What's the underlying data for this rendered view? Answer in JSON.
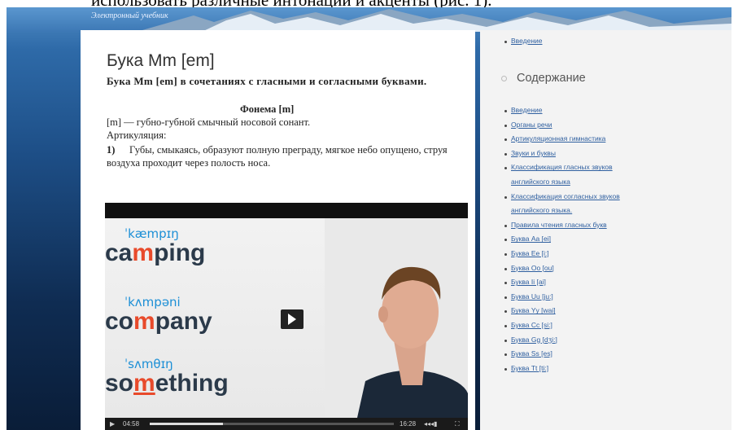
{
  "caption_top": "использовать различные интонации и акценты (рис. 1).",
  "site": {
    "title": "Электронный учебник"
  },
  "main": {
    "title": "Бука Mm [em]",
    "subheading": "Бука Mm [em] в сочетаниях с гласными и согласными буквами.",
    "phoneme_title": "Фонема [m]",
    "phoneme_desc": "[m] — губно-губной смычный носовой сонант.",
    "articulation_label": "Артикуляция:",
    "item_number": "1)",
    "item_text": "Губы, смыкаясь, образуют полную преграду, мягкое небо опущено, струя воздуха проходит через полость носа."
  },
  "video": {
    "words": [
      {
        "ipa": "ˈkæmpɪŋ",
        "pre": "ca",
        "hl": "m",
        "post": "ping"
      },
      {
        "ipa": "ˈkʌmpəni",
        "pre": "co",
        "hl": "m",
        "post": "pany"
      },
      {
        "ipa": "ˈsʌmθɪŋ",
        "pre": "so",
        "hl": "m",
        "post": "ething"
      }
    ],
    "time_current": "04:58",
    "time_total": "16:28",
    "progress": 0.3
  },
  "sidebar": {
    "top_link": "Введение",
    "heading": "Содержание",
    "items": [
      "Введение",
      "Органы речи",
      "Артикуляционная гимнастика",
      "Звуки и буквы",
      "Классификация гласных звуков",
      "английского языка",
      "Классификация согласных звуков",
      "английского языка.",
      "Правила чтения гласных букв",
      "Буква Aa [ei]",
      "Буква Ee [i:]",
      "Буква Oo [ou]",
      "Буква Ii [ai]",
      "Буква Uu [ju:]",
      "Буква Yy [wai]",
      "Буква Cc [si:]",
      "Буква Gg [dʒi:]",
      "Буква Ss [es]",
      "Буква Tt [ti:]"
    ]
  }
}
